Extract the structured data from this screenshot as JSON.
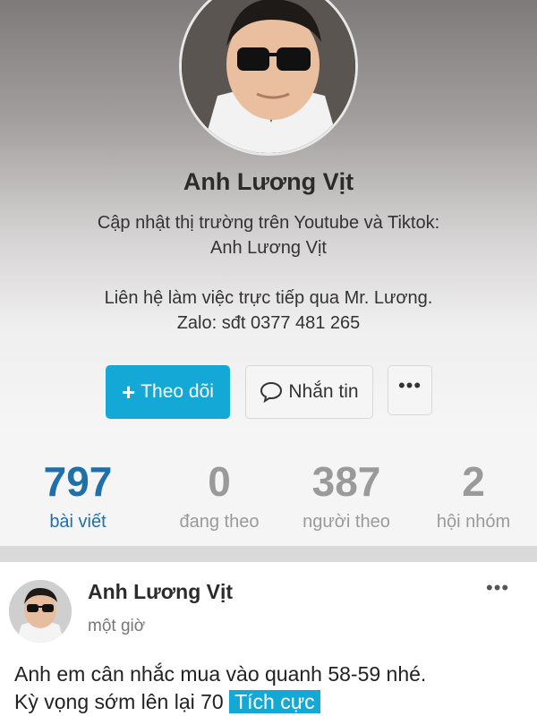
{
  "profile": {
    "name": "Anh Lương Vịt",
    "bio_lines": [
      "Cập nhật thị trường trên Youtube và Tiktok:",
      "Anh Lương Vịt",
      "",
      "Liên hệ làm việc trực tiếp qua Mr. Lương.",
      "Zalo: sđt 0377 481 265"
    ]
  },
  "actions": {
    "follow_icon": "+",
    "follow_label": "Theo dõi",
    "message_label": "Nhắn tin",
    "more_label": "•••"
  },
  "stats": [
    {
      "value": "797",
      "label": "bài viết"
    },
    {
      "value": "0",
      "label": "đang theo"
    },
    {
      "value": "387",
      "label": "người theo"
    },
    {
      "value": "2",
      "label": "hội nhóm"
    }
  ],
  "post": {
    "author": "Anh Lương Vịt",
    "time": "một giờ",
    "more_label": "•••",
    "line1": "Anh em cân nhắc mua vào quanh 58-59 nhé.",
    "line2_text": "Kỳ vọng sớm lên lại 70 ",
    "tag": "Tích cực"
  },
  "colors": {
    "accent": "#13a8d6",
    "stat_active": "#1f6fa8",
    "stat_inactive": "#9a9a9a"
  }
}
